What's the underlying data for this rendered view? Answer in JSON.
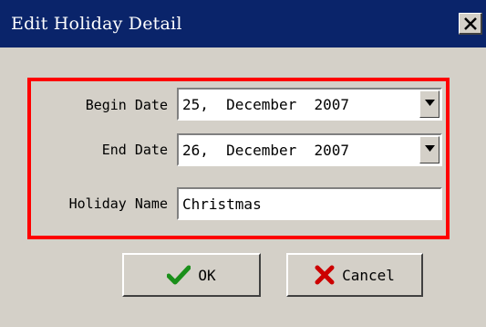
{
  "window": {
    "title": "Edit Holiday Detail"
  },
  "form": {
    "begin_date": {
      "label": "Begin Date",
      "value": "25,  December  2007"
    },
    "end_date": {
      "label": "End Date",
      "value": "26,  December  2007"
    },
    "holiday_name": {
      "label": "Holiday Name",
      "value": "Christmas"
    }
  },
  "buttons": {
    "ok": "OK",
    "cancel": "Cancel"
  },
  "colors": {
    "titlebar": "#0a246a",
    "highlight_border": "#ff0000",
    "face": "#d4d0c8",
    "ok_icon": "#1a8f1a",
    "cancel_icon": "#cc0000"
  },
  "icons": {
    "close": "close-icon",
    "ok": "checkmark-icon",
    "cancel": "x-icon",
    "dropdown": "chevron-down-icon"
  }
}
